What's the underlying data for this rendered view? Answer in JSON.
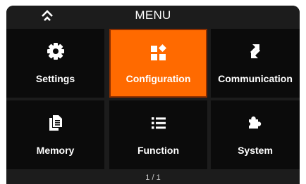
{
  "header": {
    "home_icon": "home-chevron-icon",
    "title": "MENU"
  },
  "menu": {
    "items": [
      {
        "id": "settings",
        "label": "Settings",
        "icon": "gear-icon",
        "selected": false
      },
      {
        "id": "configuration",
        "label": "Configuration",
        "icon": "configuration-blocks-icon",
        "selected": true
      },
      {
        "id": "communication",
        "label": "Communication",
        "icon": "exchange-arrows-icon",
        "selected": false
      },
      {
        "id": "memory",
        "label": "Memory",
        "icon": "documents-icon",
        "selected": false
      },
      {
        "id": "function",
        "label": "Function",
        "icon": "list-icon",
        "selected": false
      },
      {
        "id": "system",
        "label": "System",
        "icon": "puzzle-piece-icon",
        "selected": false
      }
    ]
  },
  "footer": {
    "page_indicator": "1 / 1"
  },
  "colors": {
    "background": "#1c1c1c",
    "tile": "#0b0b0b",
    "selected_tile": "#ff6a00",
    "selected_border": "#8a2e00",
    "text": "#ffffff"
  }
}
